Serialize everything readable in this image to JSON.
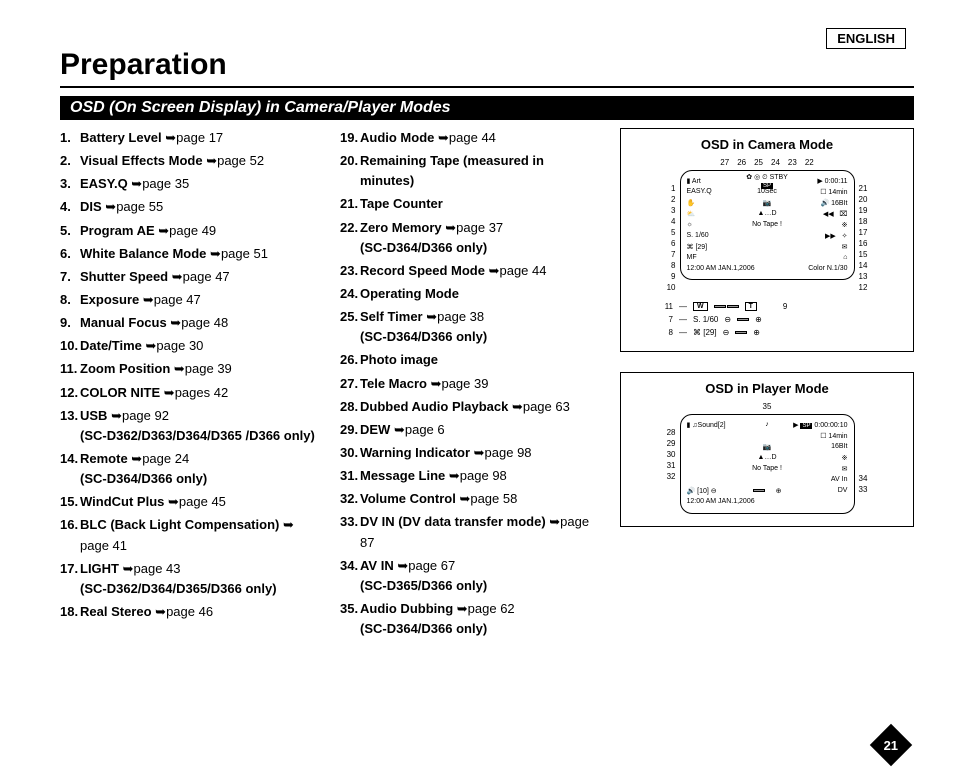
{
  "language": "ENGLISH",
  "title": "Preparation",
  "section_header": "OSD (On Screen Display) in Camera/Player Modes",
  "page_number": "21",
  "items_col1": [
    {
      "n": "1.",
      "label": "Battery Level",
      "ref": "page 17"
    },
    {
      "n": "2.",
      "label": "Visual Effects Mode",
      "ref": "page 52"
    },
    {
      "n": "3.",
      "label": "EASY.Q",
      "ref": "page 35"
    },
    {
      "n": "4.",
      "label": "DIS",
      "ref": "page 55"
    },
    {
      "n": "5.",
      "label": "Program AE",
      "ref": "page 49"
    },
    {
      "n": "6.",
      "label": "White Balance Mode",
      "ref": "page 51"
    },
    {
      "n": "7.",
      "label": "Shutter Speed",
      "ref": "page 47"
    },
    {
      "n": "8.",
      "label": "Exposure",
      "ref": "page 47"
    },
    {
      "n": "9.",
      "label": "Manual Focus",
      "ref": "page 48"
    },
    {
      "n": "10.",
      "label": "Date/Time",
      "ref": "page 30"
    },
    {
      "n": "11.",
      "label": "Zoom Position",
      "ref": "page 39"
    },
    {
      "n": "12.",
      "label": "COLOR NITE",
      "ref": "pages 42"
    },
    {
      "n": "13.",
      "label": "USB",
      "ref": "page 92",
      "note": "(SC-D362/D363/D364/D365 /D366 only)"
    },
    {
      "n": "14.",
      "label": "Remote",
      "ref": "page 24",
      "note": "(SC-D364/D366 only)"
    },
    {
      "n": "15.",
      "label": "WindCut Plus",
      "ref": "page 45"
    },
    {
      "n": "16.",
      "label": "BLC (Back Light Compensation)",
      "ref": "page 41"
    },
    {
      "n": "17.",
      "label": "LIGHT",
      "ref": "page 43",
      "note": "(SC-D362/D364/D365/D366 only)"
    },
    {
      "n": "18.",
      "label": "Real Stereo",
      "ref": "page 46"
    }
  ],
  "items_col2": [
    {
      "n": "19.",
      "label": "Audio Mode",
      "ref": "page 44"
    },
    {
      "n": "20.",
      "label": "Remaining Tape (measured in minutes)",
      "ref": ""
    },
    {
      "n": "21.",
      "label": "Tape Counter",
      "ref": ""
    },
    {
      "n": "22.",
      "label": "Zero Memory",
      "ref": "page 37",
      "note": "(SC-D364/D366 only)"
    },
    {
      "n": "23.",
      "label": "Record Speed Mode",
      "ref": "page 44"
    },
    {
      "n": "24.",
      "label": "Operating Mode",
      "ref": ""
    },
    {
      "n": "25.",
      "label": "Self Timer",
      "ref": "page 38",
      "note": "(SC-D364/D366 only)"
    },
    {
      "n": "26.",
      "label": "Photo image",
      "ref": ""
    },
    {
      "n": "27.",
      "label": "Tele Macro",
      "ref": "page 39"
    },
    {
      "n": "28.",
      "label": "Dubbed Audio Playback",
      "ref": "page 63"
    },
    {
      "n": "29.",
      "label": "DEW",
      "ref": "page 6"
    },
    {
      "n": "30.",
      "label": "Warning Indicator",
      "ref": "page 98"
    },
    {
      "n": "31.",
      "label": "Message Line",
      "ref": "page 98"
    },
    {
      "n": "32.",
      "label": "Volume Control",
      "ref": "page 58"
    },
    {
      "n": "33.",
      "label": "DV IN (DV data transfer mode)",
      "ref": "page 87"
    },
    {
      "n": "34.",
      "label": "AV IN",
      "ref": "page 67",
      "note": "(SC-D365/D366 only)"
    },
    {
      "n": "35.",
      "label": "Audio Dubbing",
      "ref": "page 62",
      "note": "(SC-D364/D366 only)"
    }
  ],
  "diagram_camera": {
    "title": "OSD in Camera Mode",
    "top_nums": [
      "27",
      "26",
      "25",
      "24",
      "23",
      "22"
    ],
    "left_nums": [
      "1",
      "2",
      "3",
      "4",
      "5",
      "6",
      "7",
      "8",
      "9",
      "10"
    ],
    "right_nums": [
      "21",
      "20",
      "19",
      "18",
      "17",
      "16",
      "15",
      "14",
      "13",
      "12"
    ],
    "screen": {
      "art": "Art",
      "easyq": "EASY.Q",
      "stby": "STBY",
      "sp": "SP",
      "timer": "10Sec",
      "counter": "0:00:11",
      "remain": "14min",
      "audio": "16BIt",
      "notape": "No Tape !",
      "dew": "…D",
      "shutter": "S. 1/60",
      "exposure": "[29]",
      "mf": "MF",
      "datetime": "12:00 AM JAN.1,2006",
      "colornite": "Color N.1/30"
    },
    "sub": {
      "n11": "11",
      "n7": "7",
      "n8": "8",
      "n9": "9",
      "w": "W",
      "t": "T",
      "shutter": "S. 1/60",
      "exp": "[29]"
    }
  },
  "diagram_player": {
    "title": "OSD in Player Mode",
    "top_nums": [
      "35"
    ],
    "left_nums": [
      "28",
      "29",
      "30",
      "31",
      "32"
    ],
    "right_nums": [
      "34",
      "33"
    ],
    "screen": {
      "sound": "Sound[2]",
      "sp": "SP",
      "counter": "0:00:00:10",
      "remain": "14min",
      "audio": "16BIt",
      "dew": "…D",
      "notape": "No Tape !",
      "avin": "AV In",
      "vol": "[10]",
      "datetime": "12:00 AM JAN.1,2006"
    }
  }
}
